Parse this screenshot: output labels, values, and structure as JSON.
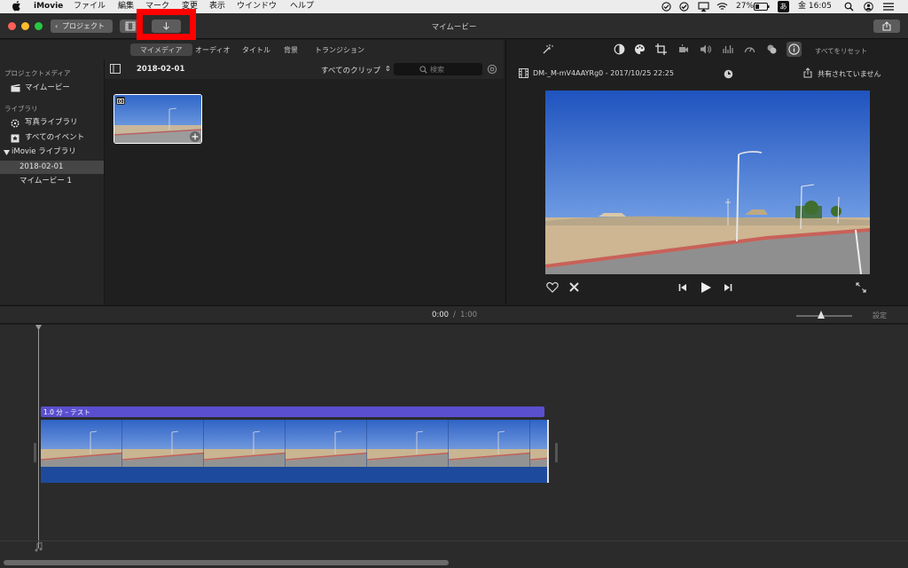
{
  "menubar": {
    "app": "iMovie",
    "items": [
      "ファイル",
      "編集",
      "マーク",
      "変更",
      "表示",
      "ウインドウ",
      "ヘルプ"
    ],
    "battery": "27%",
    "input_method": "あ",
    "clock": "金 16:05"
  },
  "toolbar": {
    "back_label": "プロジェクト",
    "window_title": "マイムービー"
  },
  "tabs": [
    "マイメディア",
    "オーディオ",
    "タイトル",
    "背景",
    "トランジション"
  ],
  "sidebar": {
    "project_media_heading": "プロジェクトメディア",
    "project_item": "マイムービー",
    "libraries_heading": "ライブラリ",
    "photos_library": "写真ライブラリ",
    "all_events": "すべてのイベント",
    "imovie_library": "iMovie ライブラリ",
    "event_selected": "2018-02-01",
    "movie_item": "マイムービー 1"
  },
  "browser": {
    "event_title": "2018-02-01",
    "filter_label": "すべてのクリップ",
    "search_placeholder": "検索"
  },
  "viewer": {
    "reset_label": "すべてをリセット",
    "clip_name": "DM-_M-mV4AAYRg0 - 2017/10/25 22:25",
    "share_status": "共有されていません"
  },
  "timeline": {
    "current_time": "0:00",
    "separator": "/",
    "total_time": "1:00",
    "settings_label": "設定",
    "title_clip_label": "1.0 分 – テスト",
    "zoom_level": 0.45
  },
  "colors": {
    "title_bar_purple": "#5a4fcf",
    "clip_blue": "#1e4a9e",
    "highlight_red": "#ff0000",
    "selection_gray": "#464646"
  },
  "icons": [
    "apple-icon",
    "film-icon",
    "import-icon",
    "share-icon",
    "search-icon",
    "gear-icon",
    "camera-icon",
    "plus-icon",
    "heart-icon",
    "reject-icon",
    "play-icon",
    "skip-back-icon",
    "skip-forward-icon",
    "fullscreen-icon",
    "clock-icon",
    "info-icon",
    "music-note-icon"
  ]
}
